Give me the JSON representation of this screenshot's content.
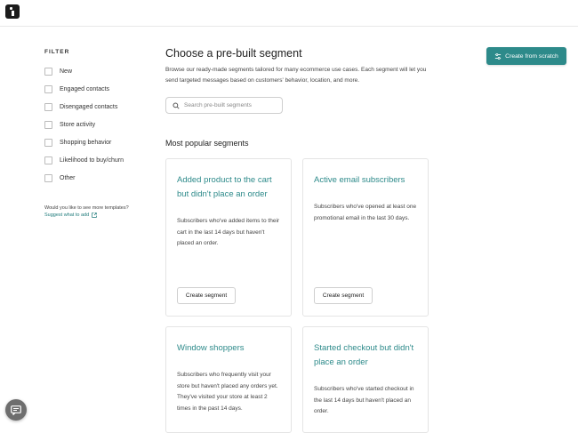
{
  "filter": {
    "heading": "FILTER",
    "items": [
      {
        "label": "New"
      },
      {
        "label": "Engaged contacts"
      },
      {
        "label": "Disengaged contacts"
      },
      {
        "label": "Store activity"
      },
      {
        "label": "Shopping behavior"
      },
      {
        "label": "Likelihood to buy/churn"
      },
      {
        "label": "Other"
      }
    ],
    "more_templates": "Would you like to see more templates?",
    "suggest_link": "Suggest what to add"
  },
  "main": {
    "title": "Choose a pre-built segment",
    "description": "Browse our ready-made segments tailored for many ecommerce use cases. Each segment will let you send targeted messages based on customers' behavior, location, and more.",
    "create_from_scratch": "Create from scratch",
    "search_placeholder": "Search pre-built segments",
    "section_title": "Most popular segments"
  },
  "cards": [
    {
      "title": "Added product to the cart but didn't place an order",
      "description": "Subscribers who've added items to their cart in the last 14 days but haven't placed an order.",
      "button": "Create segment"
    },
    {
      "title": "Active email subscribers",
      "description": "Subscribers who've opened at least one promotional email in the last 30 days.",
      "button": "Create segment"
    },
    {
      "title": "Window shoppers",
      "description": "Subscribers who frequently visit your store but haven't placed any orders yet. They've visited your store at least 2 times in the past 14 days.",
      "button": ""
    },
    {
      "title": "Started checkout but didn't place an order",
      "description": "Subscribers who've started checkout in the last 14 days but haven't placed an order.",
      "button": ""
    }
  ],
  "icons": {
    "logo": "app-logo",
    "search": "search-icon",
    "create": "sliders-icon",
    "external": "external-link-icon",
    "chat": "chat-icon"
  },
  "colors": {
    "accent": "#2d8a8a",
    "link": "#1d7a7a"
  }
}
